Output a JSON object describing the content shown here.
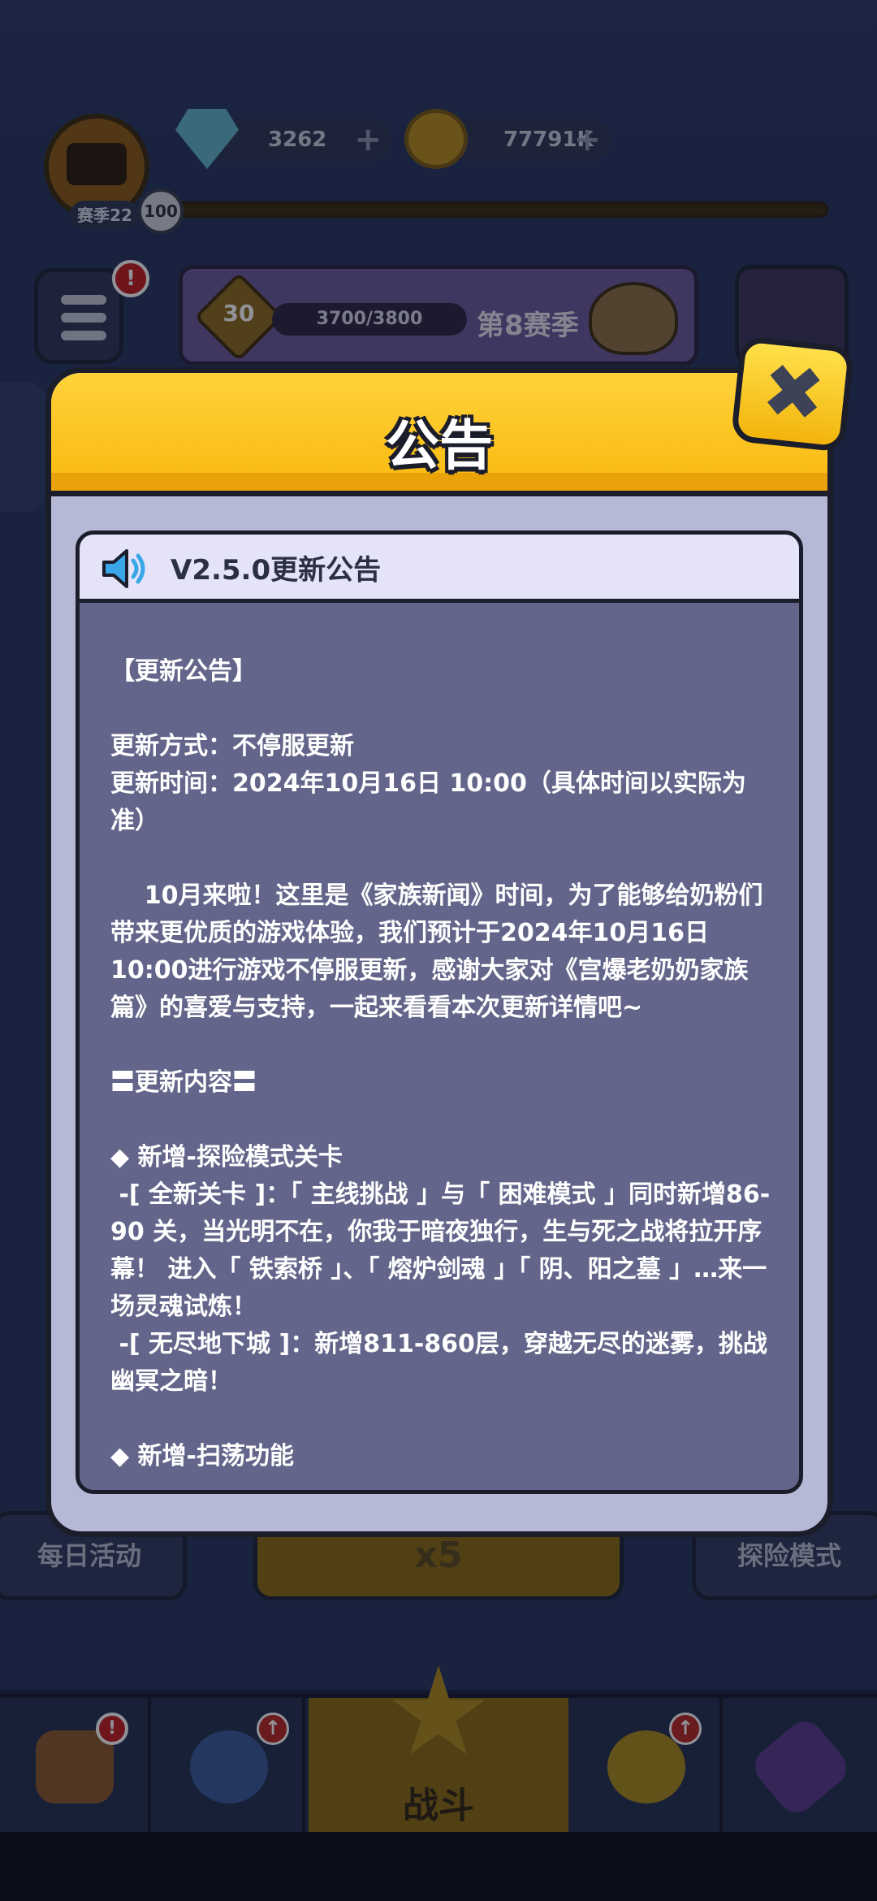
{
  "hud": {
    "season_label": "赛季22",
    "player_level": "100",
    "gems": "3262",
    "coins": "77791K",
    "plus_symbol": "+"
  },
  "season_panel": {
    "level": "30",
    "xp": "3700/3800",
    "season_name": "第8赛季",
    "badge_count": "!"
  },
  "modes": {
    "daily": "每日活动",
    "adventure": "探险模式",
    "energy": "x5"
  },
  "bottom_nav": {
    "battle_label": "战斗",
    "badge_alert": "!",
    "badge_up": "↑"
  },
  "modal": {
    "title": "公告",
    "close_symbol": "✖",
    "notice_title": "V2.5.0更新公告",
    "body": [
      "【更新公告】",
      "",
      "更新方式：不停服更新",
      "更新时间：2024年10月16日 10:00（具体时间以实际为准）",
      "",
      "    10月来啦！这里是《家族新闻》时间，为了能够给奶粉们带来更优质的游戏体验，我们预计于2024年10月16日10:00进行游戏不停服更新，感谢大家对《宫爆老奶奶家族篇》的喜爱与支持，一起来看看本次更新详情吧~",
      "",
      "〓更新内容〓",
      "",
      "◆ 新增-探险模式关卡",
      " -[ 全新关卡 ]：「 主线挑战 」与「 困难模式 」同时新增86-90 关，当光明不在，你我于暗夜独行，生与死之战将拉开序幕！ 进入「 铁索桥 」、「 熔炉剑魂 」「 阴、阳之墓 」…来一场灵魂试炼！",
      " -[ 无尽地下城 ]：新增811-860层，穿越无尽的迷雾，挑战幽冥之暗！",
      "",
      "◆ 新增-扫荡功能"
    ]
  },
  "colors": {
    "header_yellow": "#ffd23a",
    "card_bg": "#63668a",
    "modal_bg": "#b6b9d6",
    "outline": "#1b1d2b"
  }
}
